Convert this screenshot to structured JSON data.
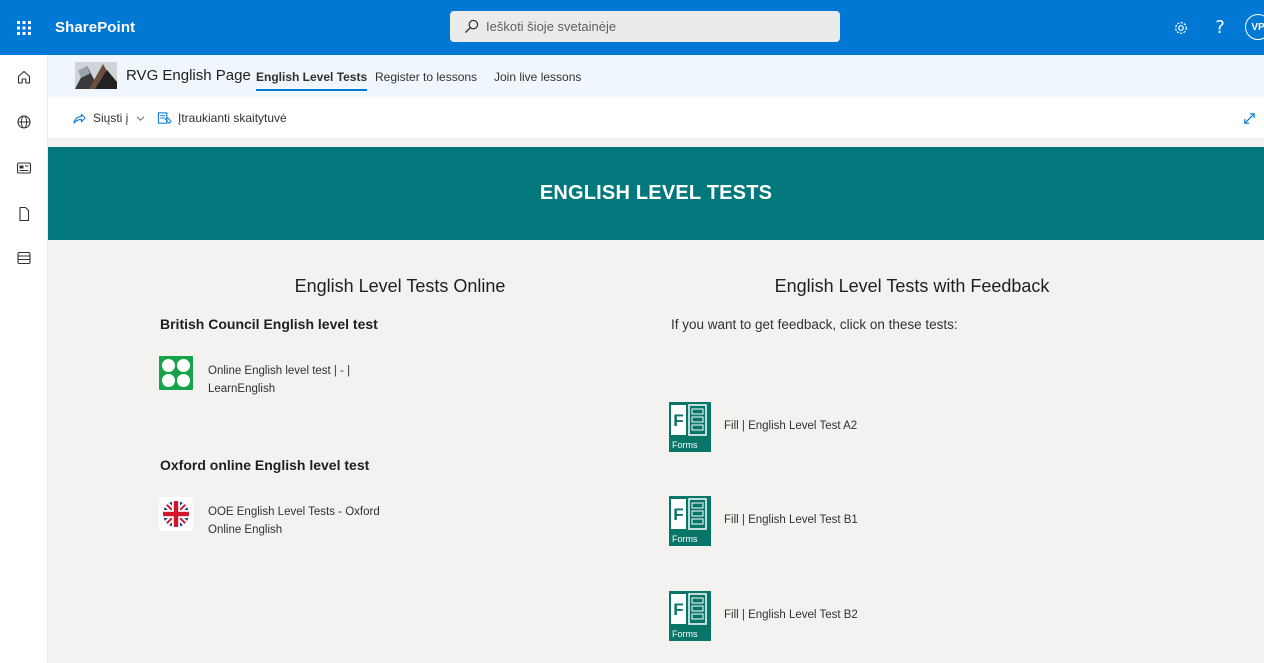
{
  "suite": {
    "brand": "SharePoint",
    "search_placeholder": "Ieškoti šioje svetainėje",
    "avatar_initials": "VP",
    "help_symbol": "?"
  },
  "site": {
    "title": "RVG English Page",
    "nav": [
      {
        "label": "English Level Tests",
        "active": true
      },
      {
        "label": "Register to lessons"
      },
      {
        "label": "Join live lessons"
      }
    ]
  },
  "commandbar": {
    "send_to": "Siųsti į",
    "immersive_reader": "Įtraukianti skaitytuvė"
  },
  "banner": {
    "title": "ENGLISH LEVEL TESTS"
  },
  "left": {
    "heading": "English Level Tests Online",
    "section1_title": "British Council English level test",
    "section1_link_line1": "Online English level test | - |",
    "section1_link_line2": "LearnEnglish",
    "section2_title": "Oxford online English level test",
    "section2_link_line1": "OOE English Level Tests - Oxford",
    "section2_link_line2": "Online English"
  },
  "right": {
    "heading": "English Level Tests with Feedback",
    "intro": "If you want to get feedback, click on these tests:",
    "forms_icon_label": "Forms",
    "tests": [
      {
        "label": "Fill | English Level Test A2"
      },
      {
        "label": "Fill | English Level Test B1"
      },
      {
        "label": "Fill | English Level Test B2"
      }
    ]
  },
  "colors": {
    "suite_bar": "#0078d4",
    "banner": "#03787c",
    "forms_green": "#077568",
    "bc_green": "#16a34a"
  }
}
